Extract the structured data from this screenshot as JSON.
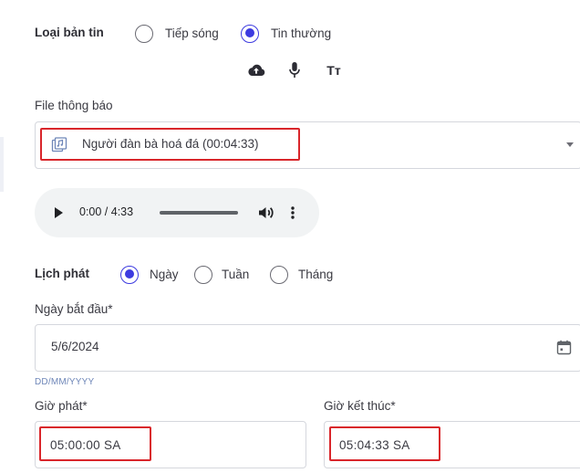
{
  "news_type": {
    "label": "Loại bản tin",
    "options": [
      {
        "label": "Tiếp sóng",
        "checked": false
      },
      {
        "label": "Tin thường",
        "checked": true
      }
    ]
  },
  "tools": [
    "upload-cloud-icon",
    "microphone-icon",
    "text-format-icon"
  ],
  "tools_text": {
    "text_tool": "Tт"
  },
  "file": {
    "label": "File thông báo",
    "selected": "Người đàn bà hoá đá (00:04:33)"
  },
  "player": {
    "time": "0:00 / 4:33",
    "progress": 0
  },
  "schedule": {
    "label": "Lịch phát",
    "options": [
      {
        "label": "Ngày",
        "checked": true
      },
      {
        "label": "Tuần",
        "checked": false
      },
      {
        "label": "Tháng",
        "checked": false
      }
    ]
  },
  "start_date": {
    "label": "Ngày bắt đầu*",
    "value": "5/6/2024",
    "hint": "DD/MM/YYYY"
  },
  "start_time": {
    "label": "Giờ phát*",
    "value": "05:00:00 SA"
  },
  "end_time": {
    "label": "Giờ kết thúc*",
    "value": "05:04:33 SA"
  },
  "colors": {
    "accent": "#3d3be0",
    "highlight": "#d9262b"
  }
}
